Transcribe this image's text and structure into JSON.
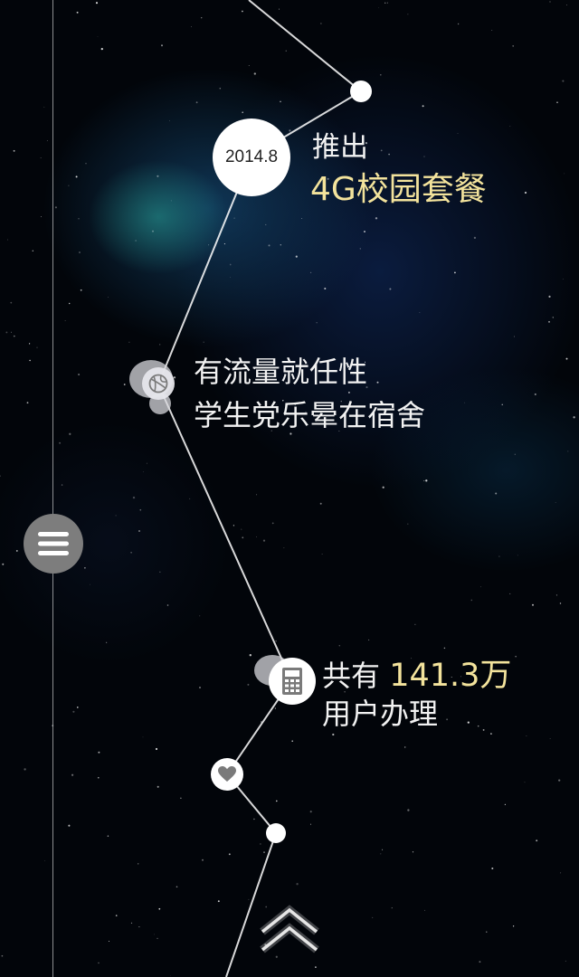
{
  "timeline": {
    "date": "2014.8",
    "launch_label": "推出",
    "launch_title": "4G校园套餐",
    "slogan_line1": "有流量就任性",
    "slogan_line2": "学生党乐晕在宿舍",
    "users_prefix": "共有 ",
    "users_count": "141.3万",
    "users_suffix": "用户办理"
  },
  "icons": {
    "menu": "menu-icon",
    "basketball": "basketball-icon",
    "calculator": "calculator-icon",
    "heart": "heart-icon",
    "scroll_up": "double-chevron-up-icon"
  },
  "colors": {
    "highlight": "#f3e39c",
    "text": "#f2f2f2",
    "background": "#02050a"
  }
}
